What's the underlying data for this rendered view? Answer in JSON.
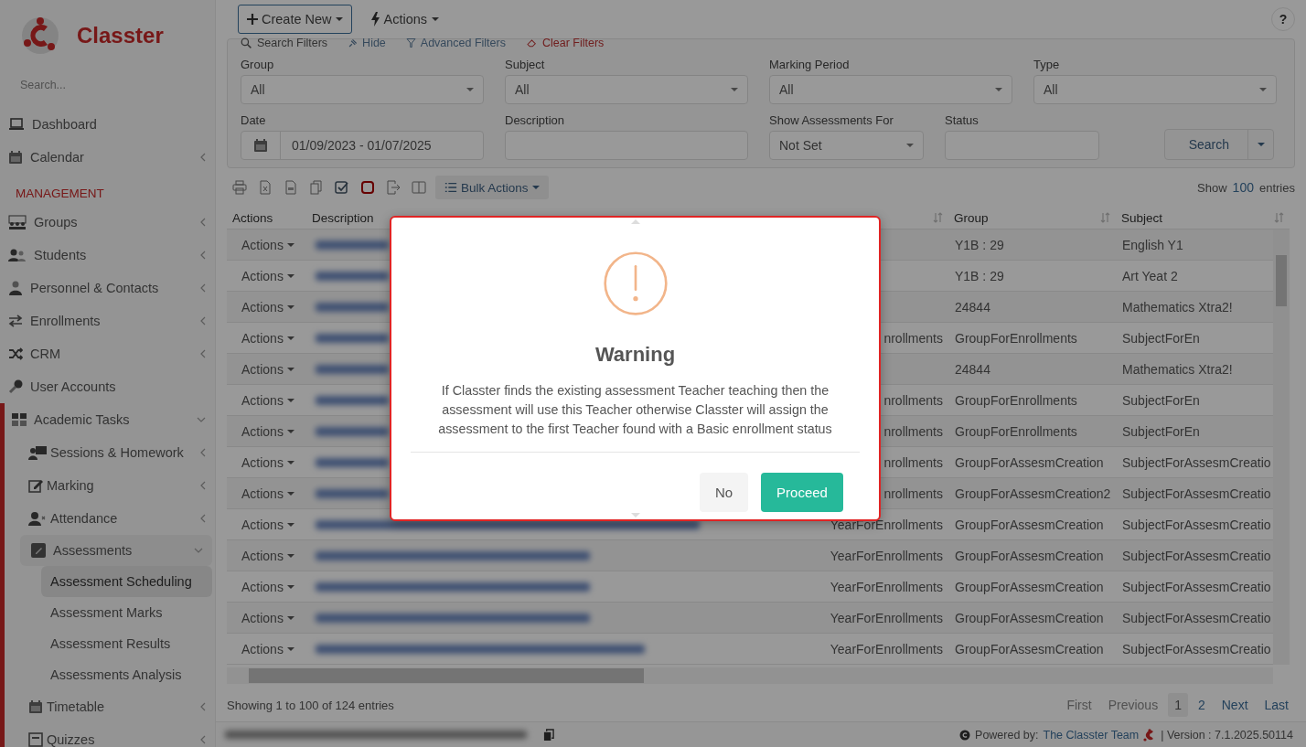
{
  "sidebar": {
    "logo": "Classter",
    "search": {
      "placeholder": "Search..."
    },
    "items": [
      {
        "label": "Dashboard",
        "kind": "leaf",
        "selected": false
      },
      {
        "label": "Calendar",
        "kind": "group",
        "expanded": false,
        "selected": false
      }
    ],
    "section_title": "MANAGEMENT",
    "management": [
      {
        "label": "Groups",
        "kind": "group",
        "expanded": false,
        "selected": false
      },
      {
        "label": "Students",
        "kind": "group",
        "expanded": false,
        "selected": false
      },
      {
        "label": "Personnel & Contacts",
        "kind": "group",
        "expanded": false,
        "selected": false
      },
      {
        "label": "Enrollments",
        "kind": "group",
        "expanded": false,
        "selected": false
      },
      {
        "label": "CRM",
        "kind": "group",
        "expanded": false,
        "selected": false
      },
      {
        "label": "User Accounts",
        "kind": "leaf",
        "selected": false
      },
      {
        "label": "Academic Tasks",
        "kind": "group",
        "expanded": true,
        "selected": false,
        "children": [
          {
            "label": "Sessions & Homework",
            "kind": "group",
            "expanded": false,
            "selected": false
          },
          {
            "label": "Marking",
            "kind": "group",
            "expanded": false,
            "selected": false
          },
          {
            "label": "Attendance",
            "kind": "group",
            "expanded": false,
            "selected": false
          },
          {
            "label": "Assessments",
            "kind": "group",
            "expanded": true,
            "selected": false,
            "children": [
              {
                "label": "Assessment Scheduling",
                "kind": "leaf",
                "selected": true
              },
              {
                "label": "Assessment Marks",
                "kind": "leaf",
                "selected": false
              },
              {
                "label": "Assessment Results",
                "kind": "leaf",
                "selected": false
              },
              {
                "label": "Assessments Analysis",
                "kind": "leaf",
                "selected": false
              }
            ]
          },
          {
            "label": "Timetable",
            "kind": "group",
            "expanded": false,
            "selected": false
          },
          {
            "label": "Quizzes",
            "kind": "group",
            "expanded": false,
            "selected": false
          }
        ]
      }
    ]
  },
  "toolbar": {
    "create_new": "Create New",
    "actions": "Actions",
    "help": "?"
  },
  "filters": {
    "links": [
      {
        "label": "Search Filters",
        "kind": "title"
      },
      {
        "label": "Hide",
        "kind": "link"
      },
      {
        "label": "Advanced Filters",
        "kind": "link"
      },
      {
        "label": "Clear Filters",
        "kind": "danger"
      }
    ],
    "rows": [
      [
        {
          "label": "Group",
          "kind": "select",
          "value": "All"
        },
        {
          "label": "Subject",
          "kind": "select",
          "value": "All"
        },
        {
          "label": "Marking Period",
          "kind": "select",
          "value": "All"
        },
        {
          "label": "Type",
          "kind": "select",
          "value": "All"
        }
      ],
      [
        {
          "label": "Date",
          "kind": "date",
          "value": "01/09/2023 - 01/07/2025"
        },
        {
          "label": "Description",
          "kind": "text"
        },
        {
          "label": "Show Assessments For",
          "kind": "select",
          "value": "Not Set"
        },
        {
          "label": "Status",
          "kind": "text"
        }
      ]
    ],
    "search_button": "Search"
  },
  "table_tools": {
    "bulk_actions": "Bulk Actions",
    "show": "Show",
    "page_size": "100",
    "entries": "entries"
  },
  "table": {
    "columns": [
      {
        "label": "Actions",
        "sortable": false
      },
      {
        "label": "Description",
        "sortable": false
      },
      {
        "sortable": true
      },
      {
        "label": "Group",
        "sortable": true
      },
      {
        "label": "Subject",
        "sortable": true
      }
    ],
    "rows": [
      {
        "action": "Actions",
        "group": "Y1B : 29",
        "subject": "English Y1"
      },
      {
        "action": "Actions",
        "group": "Y1B : 29",
        "subject": "Art Yeat 2"
      },
      {
        "action": "Actions",
        "group": "24844",
        "subject": "Mathematics Xtra2!"
      },
      {
        "action": "Actions",
        "year": "nrollments",
        "group": "GroupForEnrollments",
        "subject": "SubjectForEn"
      },
      {
        "action": "Actions",
        "group": "24844",
        "subject": "Mathematics Xtra2!"
      },
      {
        "action": "Actions",
        "year": "nrollments",
        "group": "GroupForEnrollments",
        "subject": "SubjectForEn"
      },
      {
        "action": "Actions",
        "year": "nrollments",
        "group": "GroupForEnrollments",
        "subject": "SubjectForEn"
      },
      {
        "action": "Actions",
        "year": "nrollments",
        "group": "GroupForAssesmCreation",
        "subject": "SubjectForAssesmCreatio"
      },
      {
        "action": "Actions",
        "year": "nrollments",
        "group": "GroupForAssesmCreation2",
        "subject": "SubjectForAssesmCreatio"
      },
      {
        "action": "Actions",
        "year": "YearForEnrollments",
        "group": "GroupForAssesmCreation",
        "subject": "SubjectForAssesmCreatio"
      },
      {
        "action": "Actions",
        "year": "YearForEnrollments",
        "group": "GroupForAssesmCreation",
        "subject": "SubjectForAssesmCreatio"
      },
      {
        "action": "Actions",
        "year": "YearForEnrollments",
        "group": "GroupForAssesmCreation",
        "subject": "SubjectForAssesmCreatio"
      },
      {
        "action": "Actions",
        "year": "YearForEnrollments",
        "group": "GroupForAssesmCreation",
        "subject": "SubjectForAssesmCreatio"
      },
      {
        "action": "Actions",
        "year": "YearForEnrollments",
        "group": "GroupForAssesmCreation",
        "subject": "SubjectForAssesmCreatio"
      }
    ]
  },
  "showing": "Showing 1 to 100 of 124 entries",
  "pagination": [
    {
      "label": "First",
      "disabled": true,
      "selected": false
    },
    {
      "label": "Previous",
      "disabled": true,
      "selected": false
    },
    {
      "label": "1",
      "disabled": false,
      "selected": true
    },
    {
      "label": "2",
      "disabled": false,
      "selected": false
    },
    {
      "label": "Next",
      "disabled": false,
      "selected": false
    },
    {
      "label": "Last",
      "disabled": false,
      "selected": false
    }
  ],
  "footer": {
    "powered_by": "Powered by:",
    "team": "The Classter Team",
    "version": "| Version : 7.1.2025.50114"
  },
  "modal": {
    "title": "Warning",
    "message": "If Classter finds the existing assessment Teacher teaching then the assessment will use this Teacher otherwise Classter will assign the assessment to the first Teacher found with a Basic enrollment status",
    "buttons": [
      {
        "label": "No",
        "kind": "secondary"
      },
      {
        "label": "Proceed",
        "kind": "primary"
      }
    ]
  }
}
